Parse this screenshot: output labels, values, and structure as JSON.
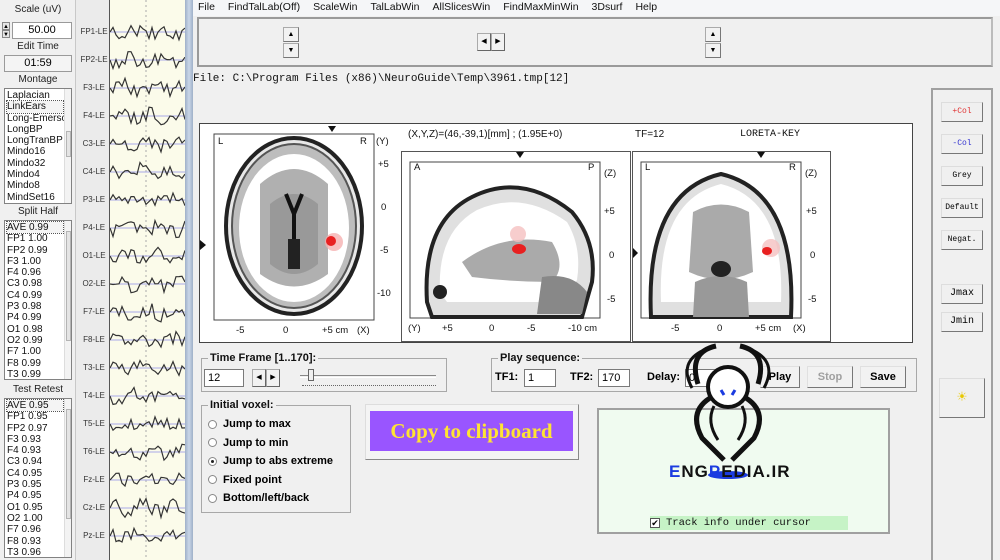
{
  "left_panel": {
    "scale_label": "Scale (uV)",
    "scale_value": "50.00",
    "edit_time_label": "Edit Time",
    "edit_time_value": "01:59",
    "montage_label": "Montage",
    "montage_items": [
      "Laplacian",
      "LinkEars",
      "Long-Emerson",
      "LongBP",
      "LongTranBP",
      "Mindo16",
      "Mindo32",
      "Mindo4",
      "Mindo8",
      "MindSet16"
    ],
    "montage_selected": "LinkEars",
    "split_half_label": "Split Half",
    "split_half_items": [
      "AVE  0.99",
      "FP1  1.00",
      "FP2  0.99",
      "F3  1.00",
      "F4  0.96",
      "C3  0.98",
      "C4  0.99",
      "P3  0.98",
      "P4  0.99",
      "O1  0.98",
      "O2  0.99",
      "F7  1.00",
      "F8  0.99",
      "T3  0.99"
    ],
    "test_retest_label": "Test Retest",
    "test_retest_items": [
      "AVE  0.95",
      "FP1  0.95",
      "FP2  0.97",
      "F3  0.93",
      "F4  0.93",
      "C3  0.94",
      "C4  0.95",
      "P3  0.95",
      "P4  0.95",
      "O1  0.95",
      "O2  1.00",
      "F7  0.96",
      "F8  0.93",
      "T3  0.96"
    ]
  },
  "eeg": {
    "channels": [
      "FP1-LE",
      "FP2-LE",
      "F3-LE",
      "F4-LE",
      "C3-LE",
      "C4-LE",
      "P3-LE",
      "P4-LE",
      "O1-LE",
      "O2-LE",
      "F7-LE",
      "F8-LE",
      "T3-LE",
      "T4-LE",
      "T5-LE",
      "T6-LE",
      "Fz-LE",
      "Cz-LE",
      "Pz-LE"
    ],
    "trace_color": "#333333",
    "baseline_color": "#a8a8e8"
  },
  "menu": [
    "File",
    "FindTalLab(Off)",
    "ScaleWin",
    "TalLabWin",
    "AllSlicesWin",
    "FindMaxMinWin",
    "3Dsurf",
    "Help"
  ],
  "file_path": "File: C:\\Program Files (x86)\\NeuroGuide\\Temp\\3961.tmp[12]",
  "brain": {
    "coord_readout": "(X,Y,Z)=(46,-39,1)[mm] ; (1.95E+0)",
    "tf_readout": "TF=12",
    "method": "LORETA-KEY",
    "axial": {
      "left": "L",
      "right": "R",
      "axis_y": "(Y)",
      "y_ticks": [
        "+5",
        "0",
        "-5",
        "-10"
      ],
      "x_ticks": [
        "-5",
        "0",
        "+5 cm"
      ],
      "axis_x": "(X)"
    },
    "sagittal": {
      "left": "A",
      "right": "P",
      "axis_z": "(Z)",
      "z_ticks": [
        "+5",
        "0",
        "-5"
      ],
      "axis_y": "(Y)",
      "y_ticks": [
        "+5",
        "0",
        "-5",
        "-10 cm"
      ]
    },
    "coronal": {
      "left": "L",
      "right": "R",
      "axis_z": "(Z)",
      "z_ticks": [
        "+5",
        "0",
        "-5"
      ],
      "x_ticks": [
        "-5",
        "0",
        "+5 cm"
      ],
      "axis_x": "(X)"
    },
    "hotspot_color": "#e82020"
  },
  "right_buttons": [
    "+Col",
    "-Col",
    "Grey",
    "Default",
    "Negat.",
    "Jmax",
    "Jmin"
  ],
  "right_button_colors": {
    "plus_col": "#e03030",
    "minus_col": "#3030d0"
  },
  "time_frame": {
    "label": "Time Frame [1..170]:",
    "value": "12",
    "slider_fraction": 0.0647
  },
  "play_sequence": {
    "label": "Play sequence:",
    "tf1_label": "TF1:",
    "tf1_value": "1",
    "tf2_label": "TF2:",
    "tf2_value": "170",
    "delay_label": "Delay:",
    "delay_value": "0",
    "play": "Play",
    "stop": "Stop",
    "save": "Save"
  },
  "initial_voxel": {
    "label": "Initial voxel:",
    "options": [
      "Jump to max",
      "Jump to min",
      "Jump to abs extreme",
      "Fixed point",
      "Bottom/left/back"
    ],
    "selected_index": 2
  },
  "copy_button": {
    "label": "Copy to clipboard",
    "bg": "#9955ff",
    "fg": "#ffe433"
  },
  "track_info": {
    "label": "Track info under cursor",
    "checked": true
  },
  "watermark": {
    "text_parts": [
      "E",
      "NG",
      "P",
      "EDIA.IR"
    ]
  }
}
